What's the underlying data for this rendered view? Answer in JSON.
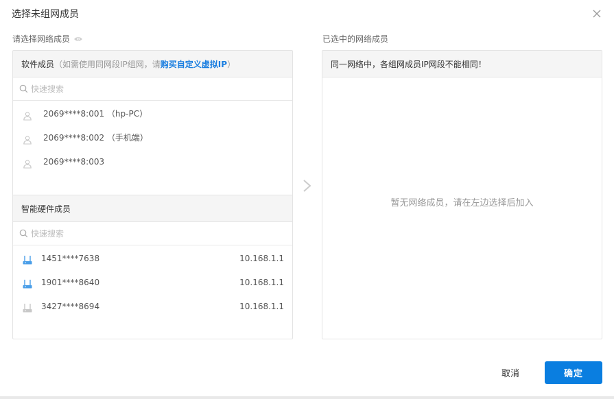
{
  "dialog": {
    "title": "选择未组网成员"
  },
  "left": {
    "label": "请选择网络成员",
    "software": {
      "header_main": "软件成员",
      "header_note_prefix": "（如需使用同网段IP组网，请 ",
      "header_link": "购买自定义虚拟IP",
      "header_note_suffix": " ）",
      "search_placeholder": "快速搜索",
      "items": [
        {
          "name": "2069****8:001 （hp-PC）"
        },
        {
          "name": "2069****8:002 （手机端）"
        },
        {
          "name": "2069****8:003"
        }
      ]
    },
    "hardware": {
      "header_main": "智能硬件成员",
      "search_placeholder": "快速搜索",
      "items": [
        {
          "name": "1451****7638",
          "ip": "10.168.1.1",
          "online": true
        },
        {
          "name": "1901****8640",
          "ip": "10.168.1.1",
          "online": true
        },
        {
          "name": "3427****8694",
          "ip": "10.168.1.1",
          "online": false
        }
      ]
    }
  },
  "right": {
    "label": "已选中的网络成员",
    "header": "同一网络中，各组网成员IP网段不能相同！",
    "empty_text": "暂无网络成员，请在左边选择后加入"
  },
  "footer": {
    "cancel_label": "取消",
    "ok_label": "确定"
  },
  "colors": {
    "accent": "#0a7ee0",
    "link": "#1a7ee0",
    "online_icon": "#4a9ee8",
    "offline_icon": "#c8c8c8"
  }
}
